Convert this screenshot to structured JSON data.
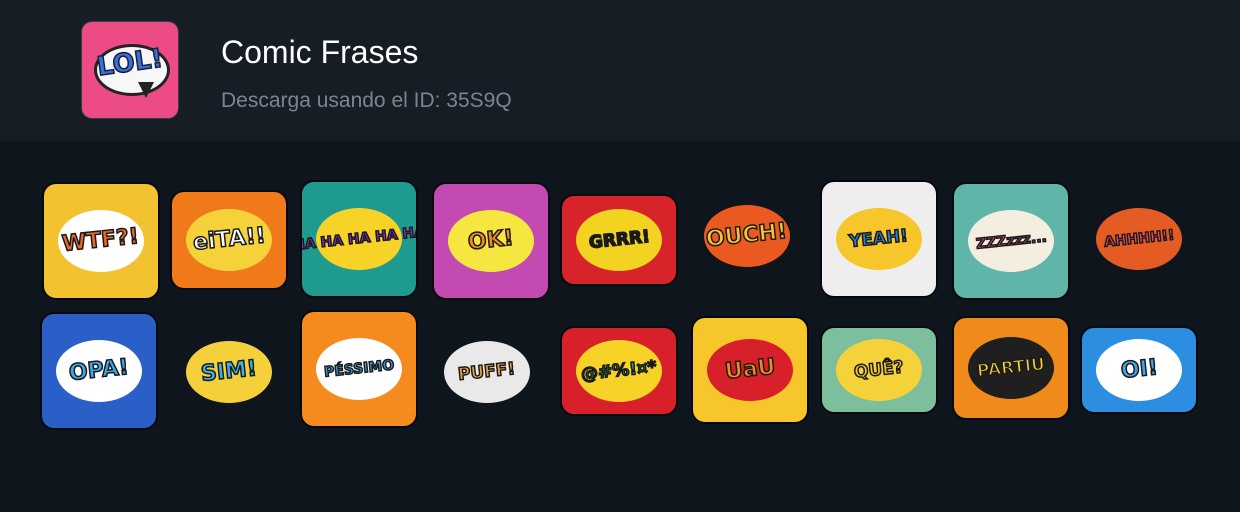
{
  "header": {
    "title": "Comic Frases",
    "subtitle": "Descarga usando el ID: 35S9Q",
    "icon_text": "LOL!"
  },
  "stickers": [
    {
      "text": "WTF?!",
      "bg": "#f2c230",
      "burst": "#ffffff",
      "color": "#e8672a"
    },
    {
      "text": "eiTA!!",
      "bg": "#f07a1a",
      "burst": "#f5d23a",
      "color": "#ffffff"
    },
    {
      "text": "HA HA HA HA HA",
      "bg": "#1f9a8f",
      "burst": "#f7d327",
      "color": "#8e2fd0"
    },
    {
      "text": "OK!",
      "bg": "#c24ab0",
      "burst": "#f6e640",
      "color": "#f28a1e"
    },
    {
      "text": "GRRR!",
      "bg": "#d7242a",
      "burst": "#f2d320",
      "color": "#1a1a1a"
    },
    {
      "text": "OUCH!",
      "bg": "transparent",
      "burst": "#ea5a20",
      "color": "#f8c530"
    },
    {
      "text": "YEAH!",
      "bg": "#eeeeee",
      "burst": "#f7c62b",
      "color": "#2c7fd4"
    },
    {
      "text": "ZZZzzz...",
      "bg": "#5fb5a8",
      "burst": "#f3eee0",
      "color": "#e74a6a"
    },
    {
      "text": "AHHHH!!",
      "bg": "transparent",
      "burst": "#e55b24",
      "color": "#ff4d6d"
    },
    {
      "text": "OPA!",
      "bg": "#2a5fc7",
      "burst": "#ffffff",
      "color": "#3fa6e8"
    },
    {
      "text": "SIM!",
      "bg": "transparent",
      "burst": "#f4d13a",
      "color": "#3fb1e8"
    },
    {
      "text": "PÉSSIMO",
      "bg": "#f58b1f",
      "burst": "#ffffff",
      "color": "#3fa6e8"
    },
    {
      "text": "PUFF!",
      "bg": "transparent",
      "burst": "#e9e9e9",
      "color": "#f1a43a"
    },
    {
      "text": "@#%!¤*",
      "bg": "#d8202a",
      "burst": "#f7d327",
      "color": "#2da14a"
    },
    {
      "text": "UaU",
      "bg": "#f7c62b",
      "burst": "#d8202a",
      "color": "#f28a1e"
    },
    {
      "text": "QUÊ?",
      "bg": "#7dbf9d",
      "burst": "#f5d23a",
      "color": "#f7c62b"
    },
    {
      "text": "PARTIU",
      "bg": "#f08a1a",
      "burst": "#1f1f1f",
      "color": "#f7d327"
    },
    {
      "text": "OI!",
      "bg": "#2b8ee0",
      "burst": "#ffffff",
      "color": "#3fa6e8"
    }
  ]
}
